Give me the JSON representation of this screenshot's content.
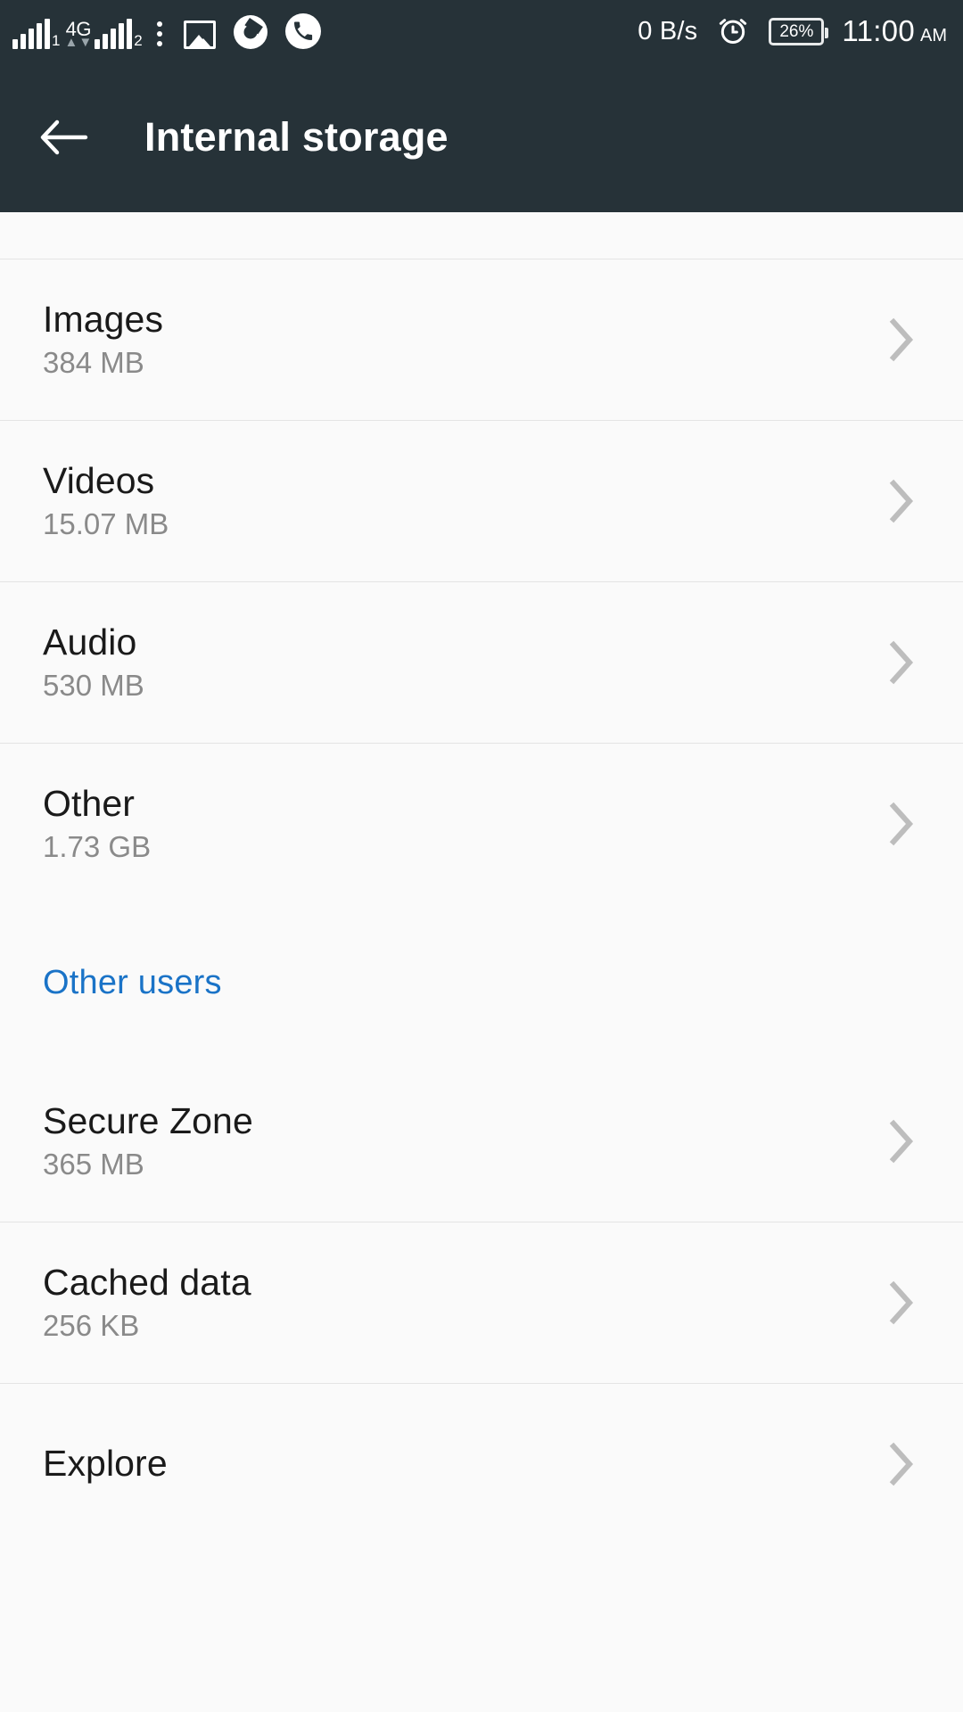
{
  "status_bar": {
    "sim1_label": "1",
    "sim2_label": "2",
    "network_type": "4G",
    "network_speed": "0 B/s",
    "battery_percent": "26%",
    "time": "11:00",
    "am_pm": "AM",
    "icons": [
      "signal-bars-sim1-icon",
      "network-4g-icon",
      "signal-bars-sim2-icon",
      "overflow-menu-icon",
      "photo-icon",
      "chrome-icon",
      "phone-icon",
      "alarm-clock-icon",
      "battery-icon"
    ]
  },
  "app_bar": {
    "back_icon": "back-arrow-icon",
    "title": "Internal storage"
  },
  "section_header": {
    "label": "Other users"
  },
  "storage_items": [
    {
      "title": "Images",
      "size": "384 MB"
    },
    {
      "title": "Videos",
      "size": "15.07 MB"
    },
    {
      "title": "Audio",
      "size": "530 MB"
    },
    {
      "title": "Other",
      "size": "1.73 GB"
    }
  ],
  "other_users_items": [
    {
      "title": "Secure Zone",
      "size": "365 MB"
    },
    {
      "title": "Cached data",
      "size": "256 KB"
    },
    {
      "title": "Explore",
      "size": ""
    }
  ],
  "colors": {
    "app_bar_bg": "#263238",
    "page_bg": "#fafafa",
    "accent_blue": "#1a73c7",
    "title_text": "#1a1a1a",
    "subtitle_text": "#8a8a8a",
    "chevron": "#bdbdbd",
    "divider": "#e4e4e4"
  }
}
